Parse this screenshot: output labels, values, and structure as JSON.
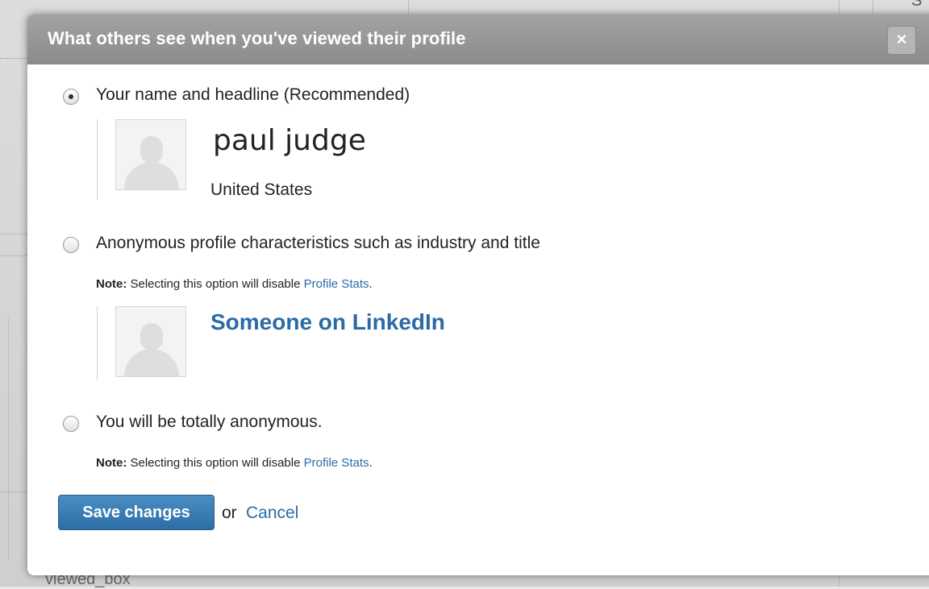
{
  "background": {
    "bottom_text": "viewed_box",
    "corner_text": "S"
  },
  "modal": {
    "title": "What others see when you've viewed their profile",
    "close_label": "×",
    "options": [
      {
        "label": "Your name and headline (Recommended)",
        "checked": true,
        "preview": {
          "name": "paul judge",
          "location": "United States"
        }
      },
      {
        "label": "Anonymous profile characteristics such as industry and title",
        "checked": false,
        "note_prefix": "Note:",
        "note_text": " Selecting this option will disable ",
        "note_link": "Profile Stats",
        "note_suffix": ".",
        "preview": {
          "name": "Someone on LinkedIn"
        }
      },
      {
        "label": "You will be totally anonymous.",
        "checked": false,
        "note_prefix": "Note:",
        "note_text": " Selecting this option will disable ",
        "note_link": "Profile Stats",
        "note_suffix": "."
      }
    ],
    "save_label": "Save changes",
    "or_text": "or",
    "cancel_label": "Cancel"
  },
  "colors": {
    "header": "#999999",
    "link": "#2b6aa6",
    "button": "#2c6ea5"
  }
}
